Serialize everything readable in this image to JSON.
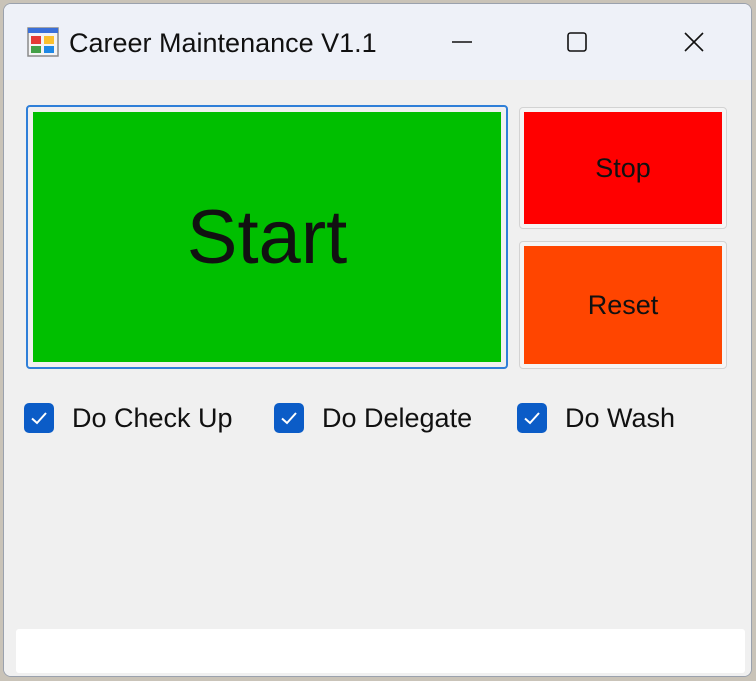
{
  "window": {
    "title": "Career Maintenance V1.1",
    "icons": {
      "app": "app-window-icon",
      "minimize": "minimize-icon",
      "maximize": "maximize-icon",
      "close": "close-icon"
    }
  },
  "buttons": {
    "start": {
      "label": "Start",
      "color": "#00BF00"
    },
    "stop": {
      "label": "Stop",
      "color": "#FF0000"
    },
    "reset": {
      "label": "Reset",
      "color": "#FF4500"
    }
  },
  "options": [
    {
      "label": "Do Check Up",
      "checked": true
    },
    {
      "label": "Do Delegate",
      "checked": true
    },
    {
      "label": "Do Wash",
      "checked": true
    }
  ],
  "status": {
    "text": ""
  }
}
